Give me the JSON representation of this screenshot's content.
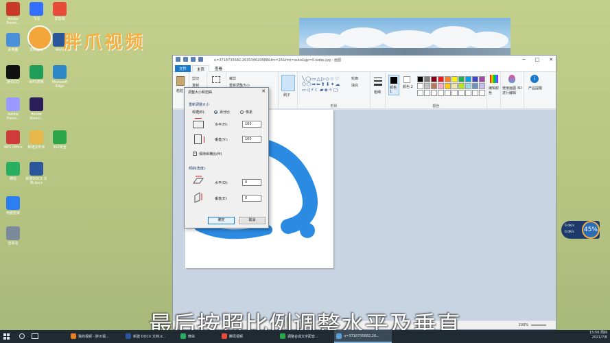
{
  "desktop": {
    "icons": [
      {
        "label": "Adobe Premi...",
        "color": "#c93a2a"
      },
      {
        "label": "飞书",
        "color": "#3370ff"
      },
      {
        "label": "爱剪辑",
        "color": "#e84b3a"
      },
      {
        "label": "此电脑",
        "color": "#4a90d9"
      },
      {
        "label": "文档编辑",
        "color": "#2b579a"
      },
      {
        "label": "Word",
        "color": "#2b579a"
      },
      {
        "label": "腾讯QQ",
        "color": "#111111"
      },
      {
        "label": "WPS表格",
        "color": "#1e9e5a"
      },
      {
        "label": "Microsoft Edge",
        "color": "#2e88c7"
      },
      {
        "label": "Adobe Premi...",
        "color": "#9999ff"
      },
      {
        "label": "Adobe Premi...",
        "color": "#2b1f5a"
      },
      {
        "label": "WPS Office",
        "color": "#d13a3a"
      },
      {
        "label": "新建文件夹",
        "color": "#e6b84a"
      },
      {
        "label": "360安全",
        "color": "#2da64a"
      },
      {
        "label": "微信",
        "color": "#27ae60"
      },
      {
        "label": "新建DOCX 文档.docx",
        "color": "#2b579a"
      },
      {
        "label": "电脑管家",
        "color": "#2d7ef3"
      },
      {
        "label": "回收站",
        "color": "#7a8a9a"
      }
    ]
  },
  "watermark": {
    "brand": "胖爪视频"
  },
  "paint": {
    "title": "u=3718735682,263534620888&fm=26&fmt=auto&gp=0.webp.jpg - 画图",
    "menu": {
      "file": "文件",
      "home": "主页",
      "view": "查看"
    },
    "ribbon": {
      "paste": "粘贴",
      "cut": "剪切",
      "copy": "复制",
      "select": "选择",
      "crop": "裁剪",
      "resize": "重新调整大小",
      "rotate": "旋转",
      "brush": "刷子",
      "shapes_label": "形状",
      "outline": "轮廓",
      "fill": "填充",
      "size": "粗细",
      "color1": "颜色 1",
      "color2": "颜色 2",
      "colors_label": "颜色",
      "edit_colors": "编辑颜色",
      "paint3d": "使用画图 3D 进行编辑",
      "product_alert": "产品提醒"
    },
    "palette": [
      "#000000",
      "#7f7f7f",
      "#880015",
      "#ed1c24",
      "#ff7f27",
      "#fff200",
      "#22b14c",
      "#00a2e8",
      "#3f48cc",
      "#a349a4",
      "#ffffff",
      "#c3c3c3",
      "#b97a57",
      "#ffaec9",
      "#ffc90e",
      "#efe4b0",
      "#b5e61d",
      "#99d9ea",
      "#7092be",
      "#c8bfe7"
    ],
    "status": {
      "zoom": "100%"
    }
  },
  "dialog": {
    "title": "调整大小和扭曲",
    "resize_section": "重新调整大小",
    "by_label": "依据(B):",
    "percent": "百分比",
    "pixels": "像素",
    "horizontal_label": "水平(H):",
    "horizontal_value": "100",
    "vertical_label": "垂直(V):",
    "vertical_value": "100",
    "keep_ratio": "保持纵横比(M)",
    "skew_section": "倾斜(角度)",
    "skew_h_label": "水平(O):",
    "skew_h_value": "0",
    "skew_v_label": "垂直(E):",
    "skew_v_value": "0",
    "ok": "确定",
    "cancel": "取消"
  },
  "subtitle": "最后按照比例调整水平及垂直",
  "widget": {
    "percent": "45%",
    "up": "0.0K/s",
    "down": "0.0K/s"
  },
  "taskbar": {
    "items": [
      {
        "label": "我的视频 - 胖爪视...",
        "color": "#e67e22"
      },
      {
        "label": "新建 DOCX 文档.d...",
        "color": "#2b579a"
      },
      {
        "label": "微信",
        "color": "#27ae60"
      },
      {
        "label": "腾讯视频",
        "color": "#e84b3a"
      },
      {
        "label": "调整合成文字配音...",
        "color": "#2da64a"
      },
      {
        "label": "u=3718735682,26...",
        "color": "#5aa0d8"
      }
    ],
    "time": "15:56 周四",
    "date": "2021/7/8"
  }
}
